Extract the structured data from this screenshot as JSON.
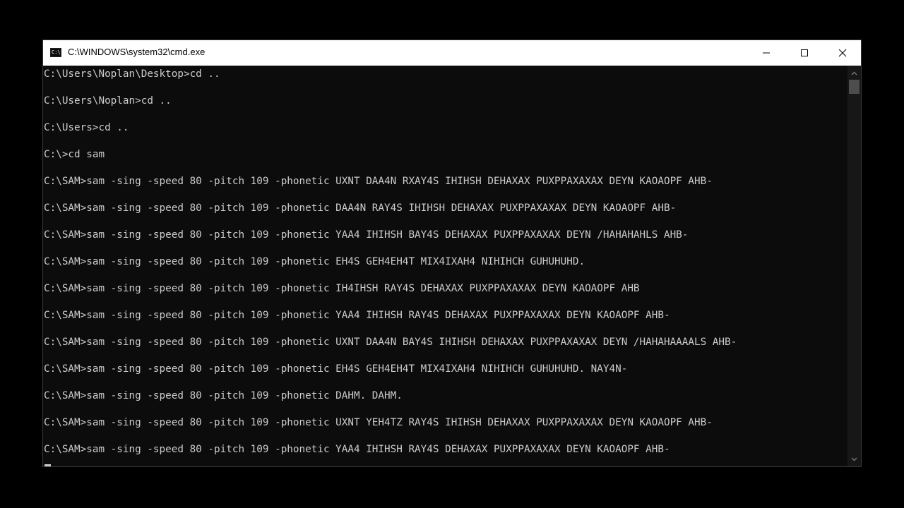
{
  "window": {
    "title": "C:\\WINDOWS\\system32\\cmd.exe",
    "icon": "cmd-console-icon",
    "icon_glyph": "C:\\"
  },
  "controls": {
    "minimize_icon": "minimize-icon",
    "maximize_icon": "maximize-icon",
    "close_icon": "close-icon"
  },
  "console": {
    "lines": [
      "C:\\Users\\Noplan\\Desktop>cd ..",
      "C:\\Users\\Noplan>cd ..",
      "C:\\Users>cd ..",
      "C:\\>cd sam",
      "C:\\SAM>sam -sing -speed 80 -pitch 109 -phonetic UXNT DAA4N RXAY4S IHIHSH DEHAXAX PUXPPAXAXAX DEYN KAOAOPF AHB-",
      "C:\\SAM>sam -sing -speed 80 -pitch 109 -phonetic DAA4N RAY4S IHIHSH DEHAXAX PUXPPAXAXAX DEYN KAOAOPF AHB-",
      "C:\\SAM>sam -sing -speed 80 -pitch 109 -phonetic YAA4 IHIHSH BAY4S DEHAXAX PUXPPAXAXAX DEYN /HAHAHAHLS AHB-",
      "C:\\SAM>sam -sing -speed 80 -pitch 109 -phonetic EH4S GEH4EH4T MIX4IXAH4 NIHIHCH GUHUHUHD.",
      "C:\\SAM>sam -sing -speed 80 -pitch 109 -phonetic IH4IHSH RAY4S DEHAXAX PUXPPAXAXAX DEYN KAOAOPF AHB",
      "C:\\SAM>sam -sing -speed 80 -pitch 109 -phonetic YAA4 IHIHSH RAY4S DEHAXAX PUXPPAXAXAX DEYN KAOAOPF AHB-",
      "C:\\SAM>sam -sing -speed 80 -pitch 109 -phonetic UXNT DAA4N BAY4S IHIHSH DEHAXAX PUXPPAXAXAX DEYN /HAHAHAAAALS AHB-",
      "C:\\SAM>sam -sing -speed 80 -pitch 109 -phonetic EH4S GEH4EH4T MIX4IXAH4 NIHIHCH GUHUHUHD. NAY4N-",
      "C:\\SAM>sam -sing -speed 80 -pitch 109 -phonetic DAHM. DAHM.",
      "C:\\SAM>sam -sing -speed 80 -pitch 109 -phonetic UXNT YEH4TZ RAY4S IHIHSH DEHAXAX PUXPPAXAXAX DEYN KAOAOPF AHB-",
      "C:\\SAM>sam -sing -speed 80 -pitch 109 -phonetic YAA4 IHIHSH RAY4S DEHAXAX PUXPPAXAXAX DEYN KAOAOPF AHB-"
    ]
  },
  "scrollbar": {
    "up_icon": "scroll-up-arrow-icon",
    "down_icon": "scroll-down-arrow-icon",
    "position": 0.0
  },
  "colors": {
    "console_background": "#0c0c0c",
    "console_text": "#cccccc",
    "titlebar_background": "#ffffff",
    "scrollbar_track": "#171717",
    "scrollbar_thumb": "#4d4d4d"
  }
}
